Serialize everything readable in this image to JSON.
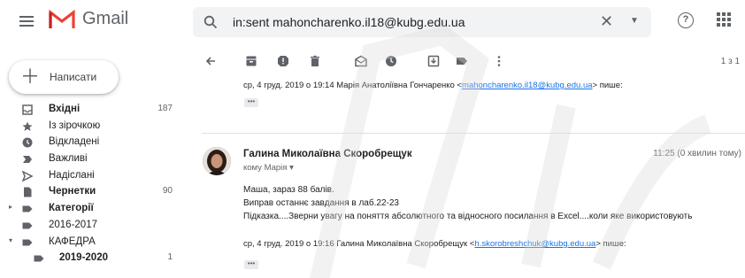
{
  "app": {
    "name": "Gmail"
  },
  "search": {
    "query": "in:sent mahoncharenko.il18@kubg.edu.ua"
  },
  "compose": {
    "label": "Написати"
  },
  "sidebar": {
    "items": [
      {
        "label": "Вхідні",
        "count": "187",
        "bold": true,
        "icon": "inbox-icon"
      },
      {
        "label": "Із зірочкою",
        "count": "",
        "bold": false,
        "icon": "star-icon"
      },
      {
        "label": "Відкладені",
        "count": "",
        "bold": false,
        "icon": "clock-icon"
      },
      {
        "label": "Важливі",
        "count": "",
        "bold": false,
        "icon": "important-icon"
      },
      {
        "label": "Надіслані",
        "count": "",
        "bold": false,
        "icon": "send-icon"
      },
      {
        "label": "Чернетки",
        "count": "90",
        "bold": true,
        "icon": "draft-icon"
      },
      {
        "label": "Категорії",
        "count": "",
        "bold": true,
        "icon": "label-icon"
      },
      {
        "label": "2016-2017",
        "count": "",
        "bold": false,
        "icon": "label-icon"
      },
      {
        "label": "КАФЕДРА",
        "count": "",
        "bold": false,
        "icon": "label-icon"
      },
      {
        "label": "2019-2020",
        "count": "1",
        "bold": true,
        "icon": "label-icon"
      }
    ]
  },
  "toolbar": {
    "pager": "1 з 1"
  },
  "thread": {
    "quote_top": {
      "prefix": "ср, 4 груд. 2019 о 19:14 Марія Анатоліївна Гончаренко <",
      "email": "mahoncharenko.il18@kubg.edu.ua",
      "suffix": "> пише:"
    },
    "message": {
      "sender": "Галина Миколаївна Скоробрещук",
      "to": "кому Марія",
      "time": "11:25 (0 хвилин тому)",
      "lines": [
        "Маша, зараз 88 балів.",
        "Виправ останнє завдання в лаб.22-23",
        "Підказка....Зверни увагу на поняття абсолютного та відносного посилання в Excel....коли яке використовують"
      ],
      "quote": {
        "prefix": "ср, 4 груд. 2019 о 19:16 Галина Миколаївна Скоробрещук <",
        "email": "h.skorobreshchuk@kubg.edu.ua",
        "suffix": "> пише:"
      }
    }
  },
  "colors": {
    "accent_red": "#ea4335",
    "link": "#1a73e8",
    "icon": "#5f6368"
  }
}
